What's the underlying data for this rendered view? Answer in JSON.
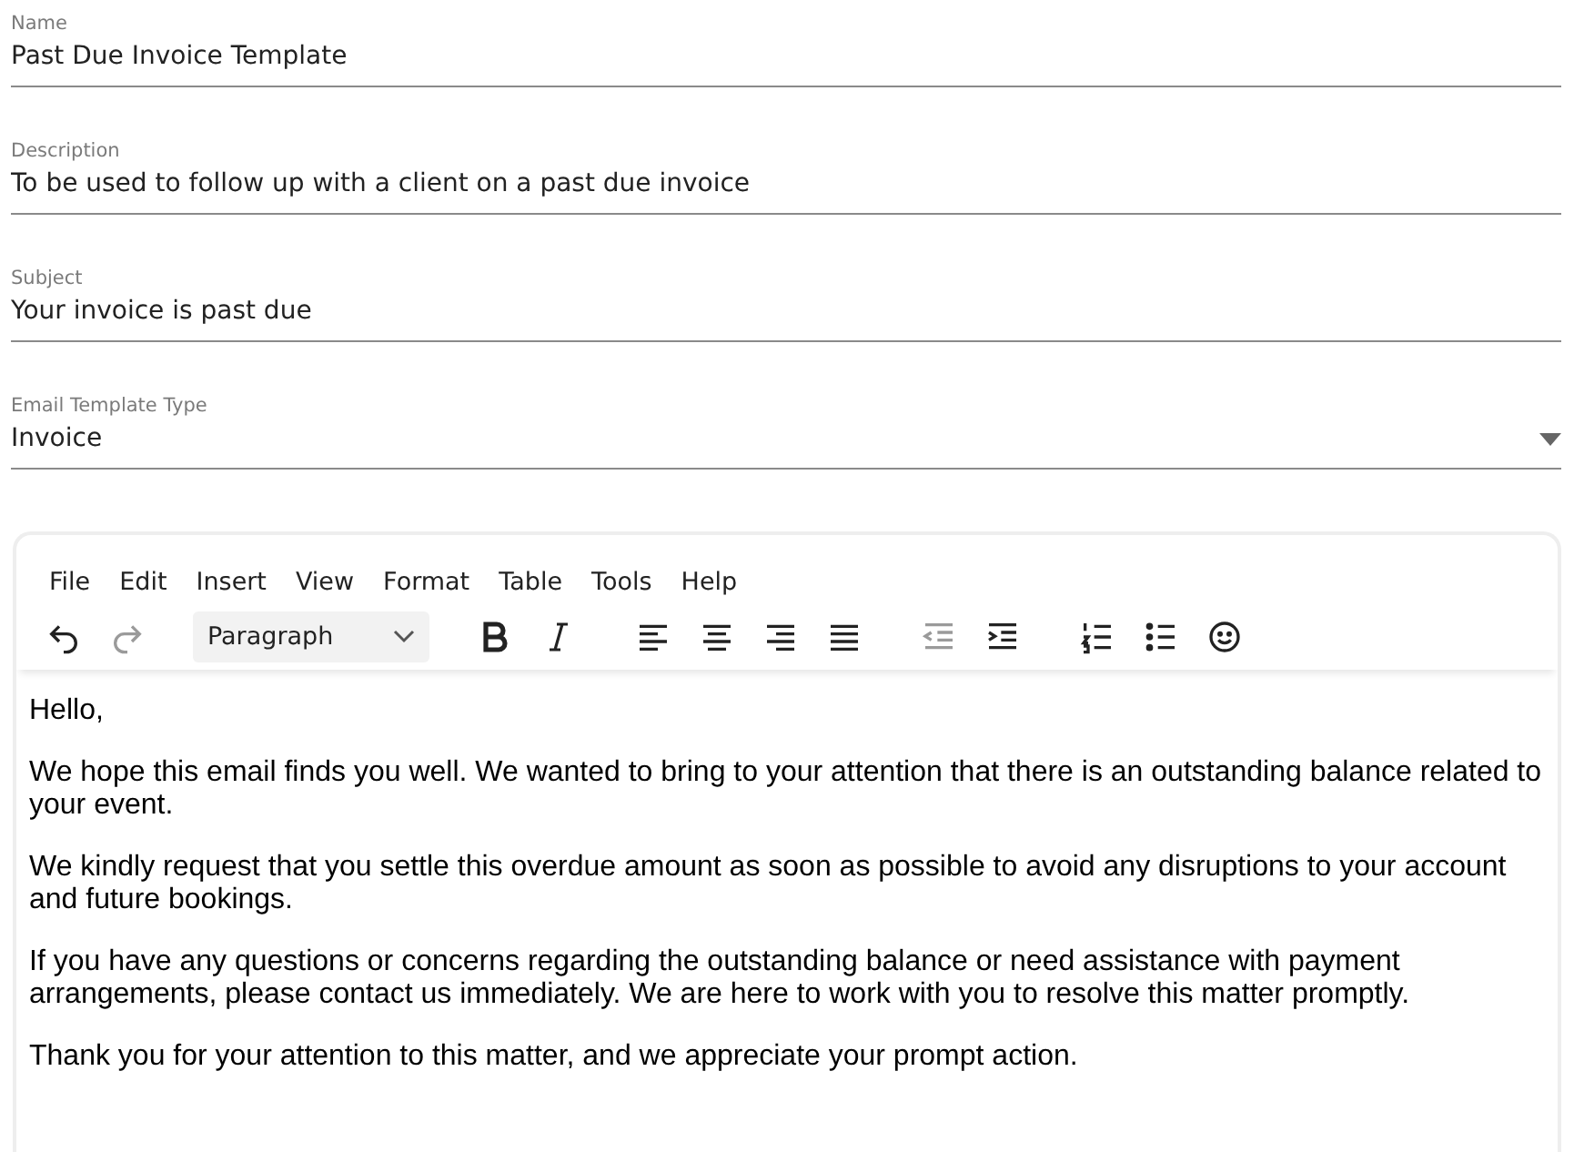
{
  "fields": [
    {
      "kind": "text",
      "label": "Name",
      "value": "Past Due Invoice Template"
    },
    {
      "kind": "text",
      "label": "Description",
      "value": "To be used to follow up with a client on a past due invoice"
    },
    {
      "kind": "text",
      "label": "Subject",
      "value": "Your invoice is past due"
    },
    {
      "kind": "select",
      "label": "Email Template Type",
      "value": "Invoice"
    }
  ],
  "editor": {
    "menu": [
      "File",
      "Edit",
      "Insert",
      "View",
      "Format",
      "Table",
      "Tools",
      "Help"
    ],
    "toolbar": [
      [
        {
          "kind": "undo",
          "disabled": false
        },
        {
          "kind": "redo",
          "disabled": true
        }
      ],
      [
        {
          "kind": "block-select",
          "value": "Paragraph"
        }
      ],
      [
        {
          "kind": "bold",
          "disabled": false
        },
        {
          "kind": "italic",
          "disabled": false
        }
      ],
      [
        {
          "kind": "align-left",
          "disabled": false
        },
        {
          "kind": "align-center",
          "disabled": false
        },
        {
          "kind": "align-right",
          "disabled": false
        },
        {
          "kind": "justify",
          "disabled": false
        }
      ],
      [
        {
          "kind": "outdent",
          "disabled": true
        },
        {
          "kind": "indent",
          "disabled": false
        }
      ],
      [
        {
          "kind": "numbered-list",
          "disabled": false
        },
        {
          "kind": "bullet-list",
          "disabled": false
        },
        {
          "kind": "emoji",
          "disabled": false
        }
      ]
    ],
    "paragraphs": [
      "Hello,",
      "We hope this email finds you well. We wanted to bring to your attention that there is an outstanding balance related to your event.",
      "We kindly request that you settle this overdue amount as soon as possible to avoid any disruptions to your account and future bookings.",
      "If you have any questions or concerns regarding the outstanding balance or need assistance with payment arrangements, please contact us immediately. We are here to work with you to resolve this matter promptly.",
      "Thank you for your attention to this matter, and we appreciate your prompt action."
    ]
  }
}
